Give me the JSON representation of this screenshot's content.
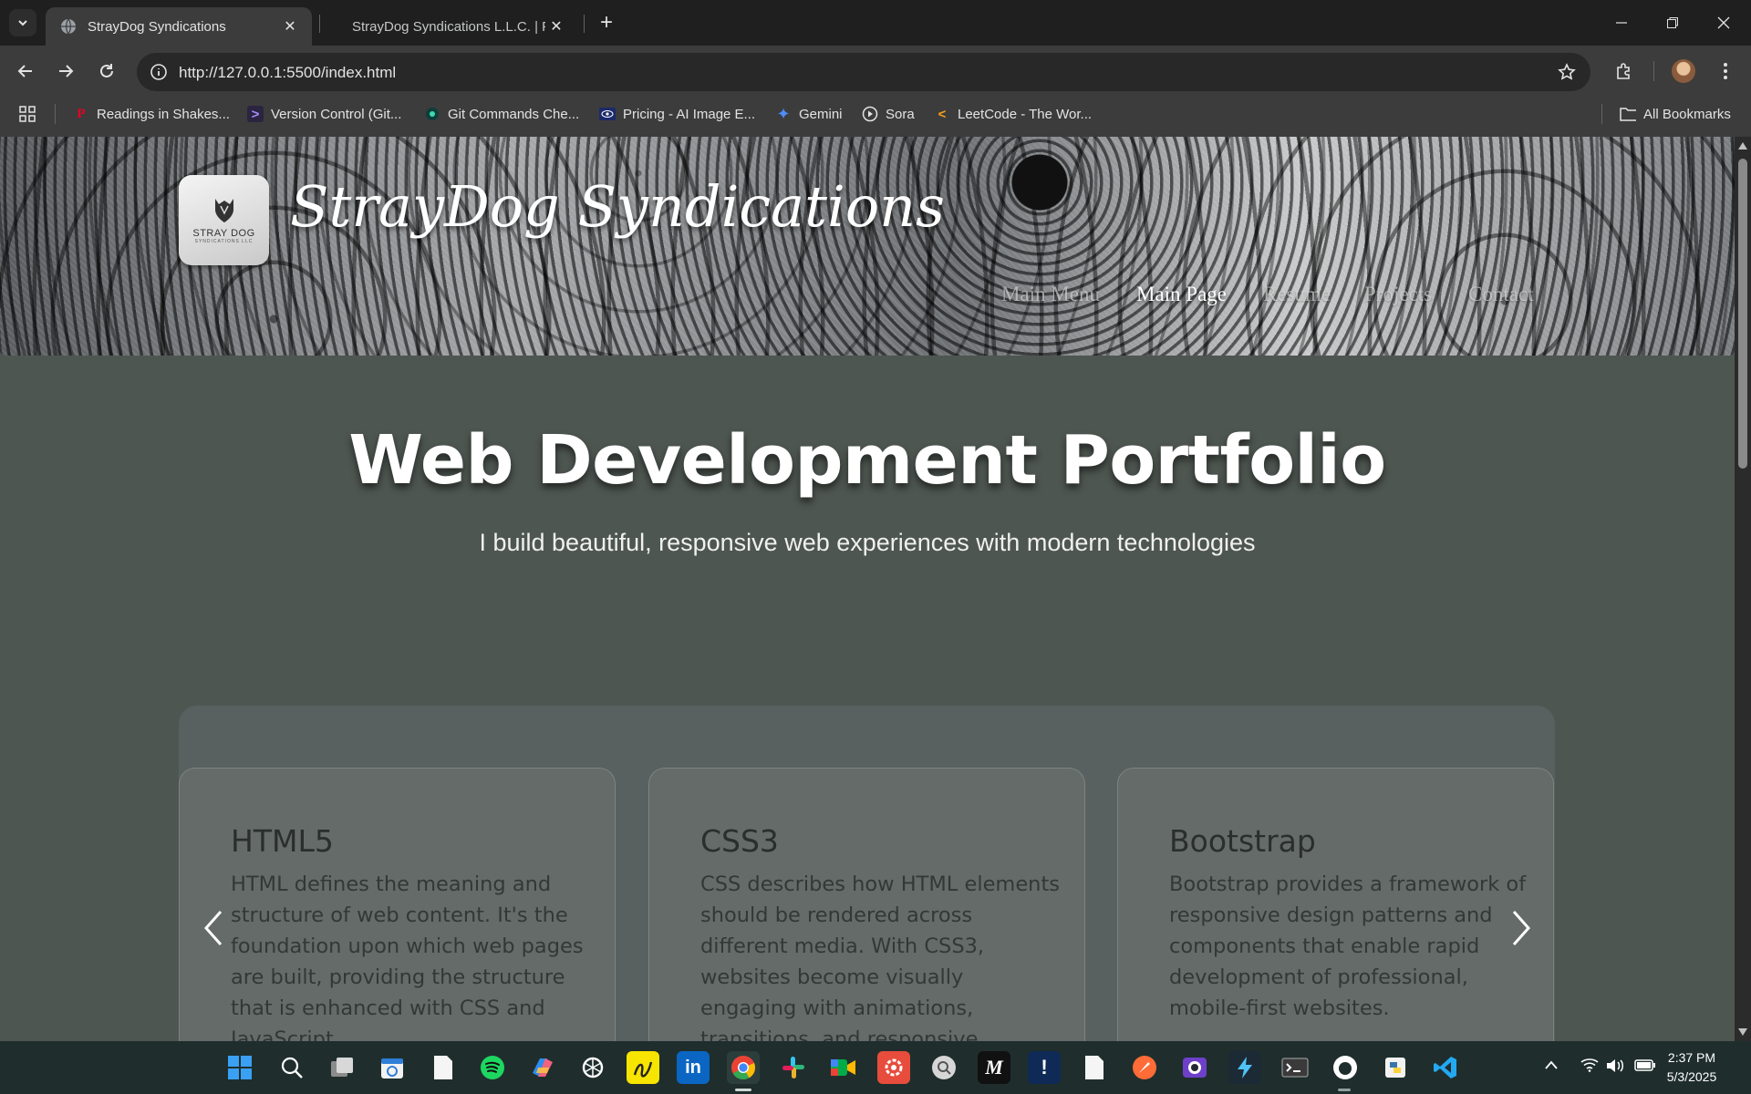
{
  "browser": {
    "tabs": [
      {
        "title": "StrayDog Syndications"
      },
      {
        "title": "StrayDog Syndications L.L.C. | Fr"
      }
    ],
    "url": "http://127.0.0.1:5500/index.html",
    "bookmarks": [
      {
        "label": "Readings in Shakes...",
        "icon": "pinterest-icon"
      },
      {
        "label": "Version Control (Git...",
        "icon": "terminal-icon"
      },
      {
        "label": "Git Commands Che...",
        "icon": "circle-icon"
      },
      {
        "label": "Pricing - AI Image E...",
        "icon": "eye-icon"
      },
      {
        "label": "Gemini",
        "icon": "gemini-star-icon"
      },
      {
        "label": "Sora",
        "icon": "sora-icon"
      },
      {
        "label": "LeetCode - The Wor...",
        "icon": "leetcode-icon"
      }
    ],
    "all_bookmarks": "All Bookmarks"
  },
  "site": {
    "brand": "StrayDog Syndications",
    "logo_text": "STRAY DOG",
    "logo_sub": "SYNDICATIONS LLC",
    "nav": [
      "Main Menu",
      "Main Page",
      "Resume",
      "Projects",
      "Contact"
    ],
    "active_nav": "Main Page",
    "headline": "Web Development Portfolio",
    "subheadline": "I build beautiful, responsive web experiences with modern technologies",
    "cards": [
      {
        "title": "HTML5",
        "body": "HTML defines the meaning and structure of web content. It's the foundation upon which web pages are built, providing the structure that is enhanced with CSS and JavaScript."
      },
      {
        "title": "CSS3",
        "body": "CSS describes how HTML elements should be rendered across different media. With CSS3, websites become visually engaging with animations, transitions, and responsive layouts."
      },
      {
        "title": "Bootstrap",
        "body": "Bootstrap provides a framework of responsive design patterns and components that enable rapid development of professional, mobile-first websites."
      }
    ]
  },
  "taskbar": {
    "time": "2:37 PM",
    "date": "5/3/2025"
  },
  "colors": {
    "page_bg": "#4e5651",
    "panel_bg": "#596060",
    "card_bg": "#646b69",
    "taskbar_bg": "#1f2e2d"
  }
}
